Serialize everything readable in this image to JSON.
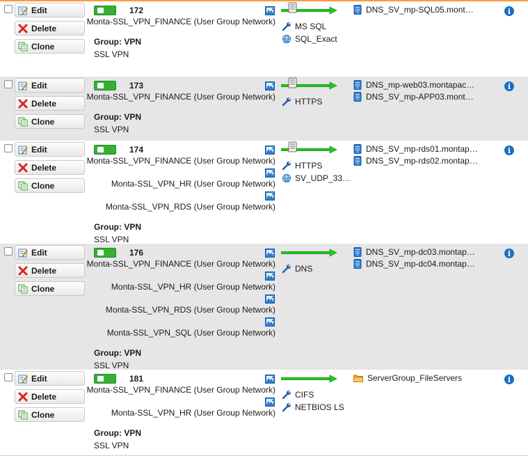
{
  "buttons": {
    "edit": "Edit",
    "delete": "Delete",
    "clone": "Clone"
  },
  "group_label": "Group: VPN",
  "info_glyph": "i",
  "colors": {
    "accent_orange": "#ff9a3c",
    "toggle_green": "#35b035",
    "arrow_green": "#22cc22",
    "info_blue": "#1a6fc4"
  },
  "rules": [
    {
      "id": "172",
      "sources": [
        "Monta-SSL_VPN_FINANCE (User Group Network)"
      ],
      "group_value": "SSL VPN",
      "has_server_icon": true,
      "services": [
        {
          "icon": "wrench-icon",
          "label": "MS SQL"
        },
        {
          "icon": "globe-icon",
          "label": "SQL_Exact"
        }
      ],
      "destinations": [
        {
          "icon": "server-icon",
          "label": "DNS_SV_mp-SQL05.mont…"
        }
      ]
    },
    {
      "id": "173",
      "sources": [
        "Monta-SSL_VPN_FINANCE (User Group Network)"
      ],
      "group_value": "SSL VPN",
      "has_server_icon": true,
      "services": [
        {
          "icon": "wrench-icon",
          "label": "HTTPS"
        }
      ],
      "destinations": [
        {
          "icon": "server-icon",
          "label": "DNS_mp-web03.montapac…"
        },
        {
          "icon": "server-icon",
          "label": "DNS_SV_mp-APP03.mont…"
        }
      ]
    },
    {
      "id": "174",
      "sources": [
        "Monta-SSL_VPN_FINANCE (User Group Network)",
        "Monta-SSL_VPN_HR (User Group Network)",
        "Monta-SSL_VPN_RDS (User Group Network)"
      ],
      "group_value": "SSL VPN",
      "has_server_icon": true,
      "services": [
        {
          "icon": "wrench-icon",
          "label": "HTTPS"
        },
        {
          "icon": "globe-icon",
          "label": "SV_UDP_33…"
        }
      ],
      "destinations": [
        {
          "icon": "server-icon",
          "label": "DNS_SV_mp-rds01.montap…"
        },
        {
          "icon": "server-icon",
          "label": "DNS_SV_mp-rds02.montap…"
        }
      ]
    },
    {
      "id": "176",
      "sources": [
        "Monta-SSL_VPN_FINANCE (User Group Network)",
        "Monta-SSL_VPN_HR (User Group Network)",
        "Monta-SSL_VPN_RDS (User Group Network)",
        "Monta-SSL_VPN_SQL (User Group Network)"
      ],
      "group_value": "SSL VPN",
      "has_server_icon": false,
      "services": [
        {
          "icon": "wrench-icon",
          "label": "DNS"
        }
      ],
      "destinations": [
        {
          "icon": "server-icon",
          "label": "DNS_SV_mp-dc03.montap…"
        },
        {
          "icon": "server-icon",
          "label": "DNS_SV_mp-dc04.montap…"
        }
      ]
    },
    {
      "id": "181",
      "sources": [
        "Monta-SSL_VPN_FINANCE (User Group Network)",
        "Monta-SSL_VPN_HR (User Group Network)"
      ],
      "group_value": "SSL VPN",
      "has_server_icon": false,
      "services": [
        {
          "icon": "wrench-icon",
          "label": "CIFS"
        },
        {
          "icon": "wrench-icon",
          "label": "NETBIOS LS"
        }
      ],
      "destinations": [
        {
          "icon": "folder-icon",
          "label": "ServerGroup_FileServers"
        }
      ]
    }
  ]
}
